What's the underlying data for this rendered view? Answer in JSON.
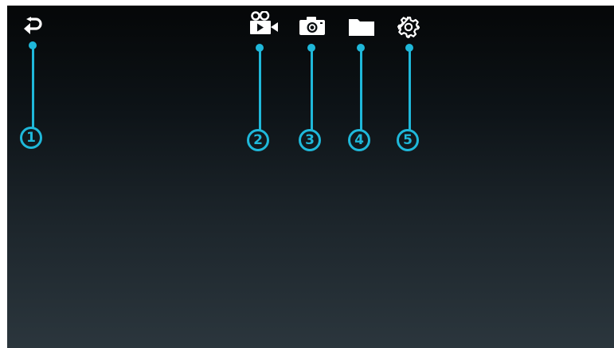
{
  "toolbar": {
    "icons": [
      "back-icon",
      "video-camera-icon",
      "camera-icon",
      "folder-icon",
      "gear-icon"
    ]
  },
  "callouts": {
    "c1": "1",
    "c2": "2",
    "c3": "3",
    "c4": "4",
    "c5": "5"
  },
  "colors": {
    "accent": "#1fb8da",
    "icon": "#ffffff",
    "background_top": "#050708",
    "background_bottom": "#2b363d"
  }
}
